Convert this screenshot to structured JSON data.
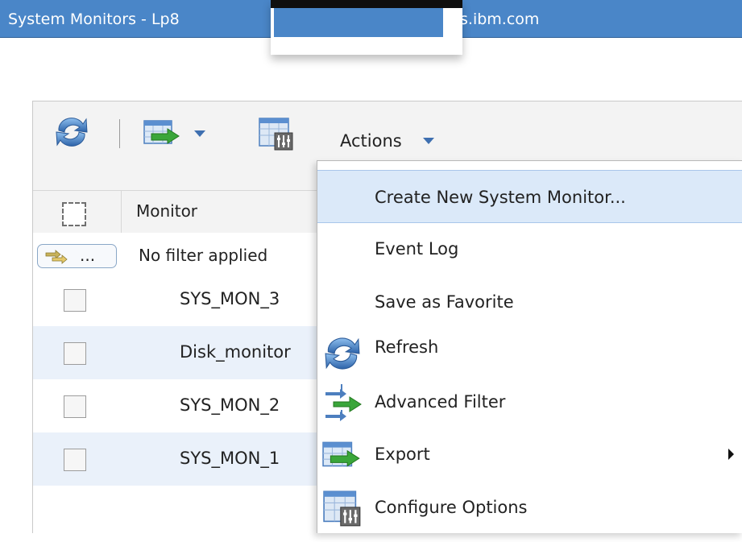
{
  "window": {
    "title_prefix": "System Monitors - Lp8",
    "title_suffix": "s.ibm.com"
  },
  "toolbar": {
    "refresh_icon": "refresh-icon",
    "export_icon": "export-icon",
    "configure_icon": "configure-options-icon",
    "actions_label": "Actions"
  },
  "table": {
    "column_header": "Monitor",
    "filter_button_text": "...",
    "filter_text": "No filter applied",
    "rows": [
      {
        "name": "SYS_MON_3"
      },
      {
        "name": "Disk_monitor"
      },
      {
        "name": "SYS_MON_2"
      },
      {
        "name": "SYS_MON_1"
      }
    ]
  },
  "menu": {
    "items": [
      {
        "label": "Create New System Monitor...",
        "icon": null,
        "selected": true
      },
      {
        "label": "Event Log",
        "icon": null
      },
      {
        "label": "Save as Favorite",
        "icon": null
      },
      {
        "label": "Refresh",
        "icon": "refresh-icon"
      },
      {
        "label": "Advanced Filter",
        "icon": "advanced-filter-icon"
      },
      {
        "label": "Export",
        "icon": "export-icon",
        "submenu": true
      },
      {
        "label": "Configure Options",
        "icon": "configure-options-icon"
      }
    ]
  },
  "colors": {
    "title_bar": "#4a86c8",
    "toolbar_bg": "#f3f3f3",
    "row_alt": "#eaf1fa",
    "menu_selected": "#dbe9f9",
    "accent_blue": "#3e6fb0",
    "export_green": "#3aa63a"
  }
}
